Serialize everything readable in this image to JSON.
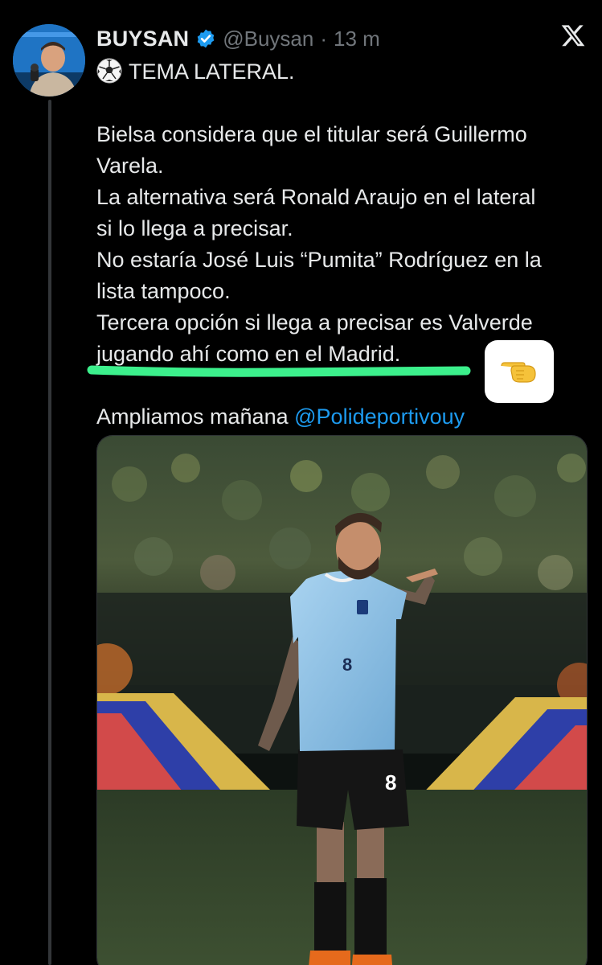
{
  "author": {
    "display_name": "BUYSAN",
    "handle": "@Buysan",
    "separator": "·",
    "time": "13 m"
  },
  "tweet": {
    "heading": "TEMA LATERAL.",
    "lines": [
      "Bielsa considera que el titular será Guillermo",
      "Varela.",
      "La alternativa será Ronald Araujo en el lateral",
      "si lo llega a precisar.",
      "No estaría José Luis “Pumita” Rodríguez en la",
      "lista tampoco.",
      "Tercera opción si llega a precisar es Valverde",
      "jugando ahí como en el Madrid."
    ],
    "closing_prefix": "Ampliamos mañana",
    "closing_mention": "@Polideportivouy"
  },
  "media": {
    "jersey_number": "8",
    "shorts_number": "8"
  },
  "icons": {
    "verified": "verified-badge-icon",
    "x": "x-logo-icon",
    "ball": "soccer-ball-icon",
    "hand": "pointing-hand-icon"
  },
  "colors": {
    "background": "#000000",
    "text": "#e7e9ea",
    "secondary": "#71767b",
    "accent": "#1d9bf0",
    "highlight": "#3cf08c"
  }
}
